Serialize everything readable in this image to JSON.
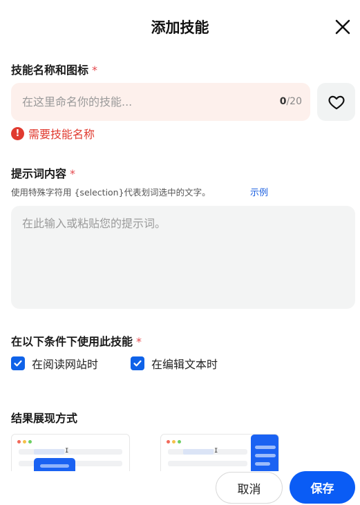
{
  "dialog": {
    "title": "添加技能"
  },
  "name_section": {
    "label": "技能名称和图标",
    "required_mark": "*",
    "input_placeholder": "在这里命名你的技能...",
    "input_value": "",
    "count_current": "0",
    "count_max": "/20",
    "icon_button_icon": "heart-icon",
    "error_text": "需要技能名称"
  },
  "prompt_section": {
    "label": "提示词内容",
    "required_mark": "*",
    "hint": "使用特殊字符用 {selection}代表划词选中的文字。",
    "hint_link": "示例",
    "textarea_placeholder": "在此输入或粘贴您的提示词。"
  },
  "conditions_section": {
    "label": "在以下条件下使用此技能",
    "required_mark": "*",
    "options": [
      {
        "label": "在阅读网站时",
        "checked": true
      },
      {
        "label": "在编辑文本时",
        "checked": true
      }
    ]
  },
  "display_section": {
    "label": "结果展现方式",
    "cursor_glyph": "I"
  },
  "footer": {
    "cancel_label": "取消",
    "save_label": "保存"
  },
  "colors": {
    "accent": "#0a5cf5",
    "error": "#e03a2f",
    "required": "#e5484d",
    "input_error_bg": "#fdf0ec"
  }
}
